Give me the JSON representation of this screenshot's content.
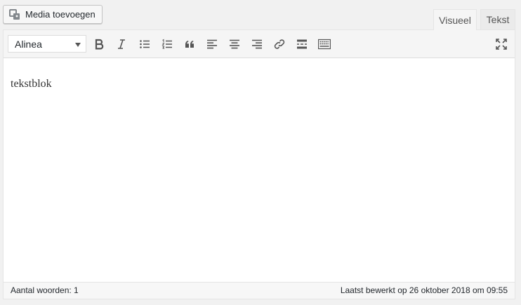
{
  "media_button": {
    "label": "Media toevoegen",
    "icon": "add-media-icon"
  },
  "tabs": {
    "visual": "Visueel",
    "text": "Tekst"
  },
  "toolbar": {
    "format_select": "Alinea",
    "buttons": [
      {
        "name": "bold",
        "icon": "bold-icon"
      },
      {
        "name": "italic",
        "icon": "italic-icon"
      },
      {
        "name": "bulleted-list",
        "icon": "bulleted-list-icon"
      },
      {
        "name": "numbered-list",
        "icon": "numbered-list-icon"
      },
      {
        "name": "blockquote",
        "icon": "blockquote-icon"
      },
      {
        "name": "align-left",
        "icon": "align-left-icon"
      },
      {
        "name": "align-center",
        "icon": "align-center-icon"
      },
      {
        "name": "align-right",
        "icon": "align-right-icon"
      },
      {
        "name": "insert-link",
        "icon": "link-icon"
      },
      {
        "name": "read-more",
        "icon": "read-more-icon"
      },
      {
        "name": "toolbar-toggle",
        "icon": "keyboard-icon"
      },
      {
        "name": "fullscreen",
        "icon": "fullscreen-icon"
      }
    ]
  },
  "content": {
    "text": "tekstblok"
  },
  "status": {
    "word_count": "Aantal woorden: 1",
    "last_edited": "Laatst bewerkt op 26 oktober 2018 om 09:55"
  }
}
